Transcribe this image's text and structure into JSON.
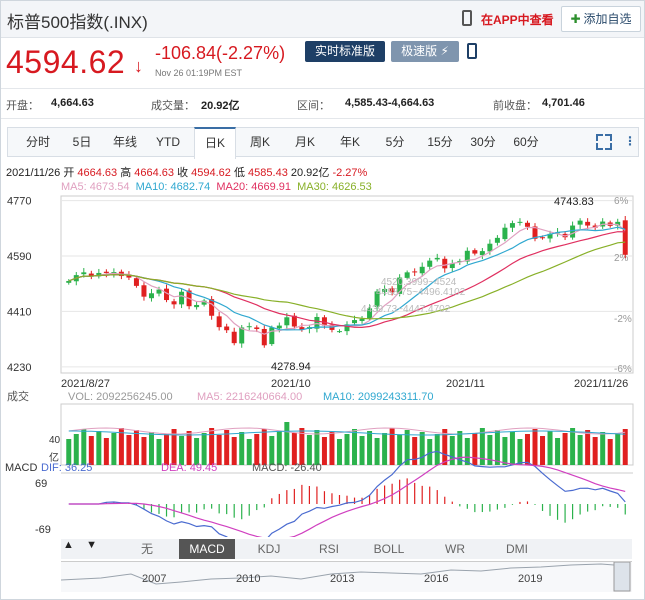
{
  "header": {
    "title": "标普500指数(.INX)",
    "app_link": "在APP中查看",
    "add_watch": "添加自选"
  },
  "quote": {
    "price": "4594.62",
    "arrow": "↓",
    "change": "-106.84(-2.27%)",
    "timestamp": "Nov 26 01:19PM EST",
    "btn_realtime": "实时标准版",
    "btn_fast": "极速版"
  },
  "stats": {
    "open_k": "开盘：",
    "open_v": "4,664.63",
    "vol_k": "成交量：",
    "vol_v": "20.92亿",
    "range_k": "区间：",
    "range_v": "4,585.43-4,664.63",
    "prev_k": "前收盘：",
    "prev_v": "4,701.46"
  },
  "tabs": [
    "分时",
    "5日",
    "年线",
    "YTD",
    "日K",
    "周K",
    "月K",
    "年K",
    "5分",
    "15分",
    "30分",
    "60分"
  ],
  "active_tab": "日K",
  "info_line": {
    "date": "2021/11/26",
    "open_k": "开",
    "open_v": "4664.63",
    "high_k": "高",
    "high_v": "4664.63",
    "close_k": "收",
    "close_v": "4594.62",
    "low_k": "低",
    "low_v": "4585.43",
    "vol": "20.92亿",
    "pct": "-2.27%"
  },
  "ma_line": {
    "ma5": "MA5: 4673.54",
    "ma10": "MA10: 4682.74",
    "ma20": "MA20: 4669.91",
    "ma30": "MA30: 4626.53"
  },
  "chart_data": {
    "type": "candlestick",
    "y_ticks": [
      "4770",
      "4590",
      "4410",
      "4230"
    ],
    "pct_ticks": [
      "6%",
      "2%",
      "-2%",
      "-6%"
    ],
    "x_ticks": [
      "2021/8/27",
      "2021/10",
      "2021/11",
      "2021/11/26"
    ],
    "annotations": [
      "4743.83",
      "4278.94",
      "4520.3999~4524",
      "4488.75~4496.4102",
      "4439.73~4447.4702"
    ],
    "ylim": [
      4210,
      4785
    ],
    "colors": {
      "up": "#2bb24c",
      "down": "#e02020",
      "ma5": "#e0a0c0",
      "ma10": "#30a8d0",
      "ma20": "#e03060",
      "ma30": "#88b028"
    },
    "closes": [
      4509,
      4528,
      4537,
      4524,
      4535,
      4535,
      4538,
      4525,
      4520,
      4493,
      4458,
      4469,
      4481,
      4447,
      4433,
      4474,
      4427,
      4431,
      4445,
      4396,
      4359,
      4349,
      4307,
      4358,
      4362,
      4353,
      4300,
      4358,
      4364,
      4391,
      4361,
      4351,
      4359,
      4392,
      4364,
      4350,
      4346,
      4368,
      4382,
      4386,
      4420,
      4475,
      4483,
      4472,
      4520,
      4537,
      4538,
      4555,
      4575,
      4584,
      4550,
      4566,
      4574,
      4607,
      4598,
      4606,
      4630,
      4649,
      4682,
      4697,
      4701,
      4685,
      4646,
      4649,
      4662,
      4667,
      4651,
      4689,
      4705,
      4689,
      4682,
      4702,
      4688,
      4701,
      4594
    ],
    "volume": {
      "label": "成交",
      "vol": "VOL: 2092256245.00",
      "ma5": "MA5: 2216240664.00",
      "ma10": "MA10: 2099243311.70",
      "ticks": [
        "40",
        "亿"
      ]
    },
    "macd": {
      "label": "MACD",
      "dif": "DIF: 36.25",
      "dea": "DEA: 49.45",
      "macd": "MACD: -26.40",
      "ticks": [
        "69",
        "-69"
      ]
    }
  },
  "indicator_tabs": [
    "无",
    "MACD",
    "KDJ",
    "RSI",
    "BOLL",
    "WR",
    "DMI"
  ],
  "active_indicator": "MACD",
  "nav_years": [
    "2007",
    "2010",
    "2013",
    "2016",
    "2019"
  ]
}
